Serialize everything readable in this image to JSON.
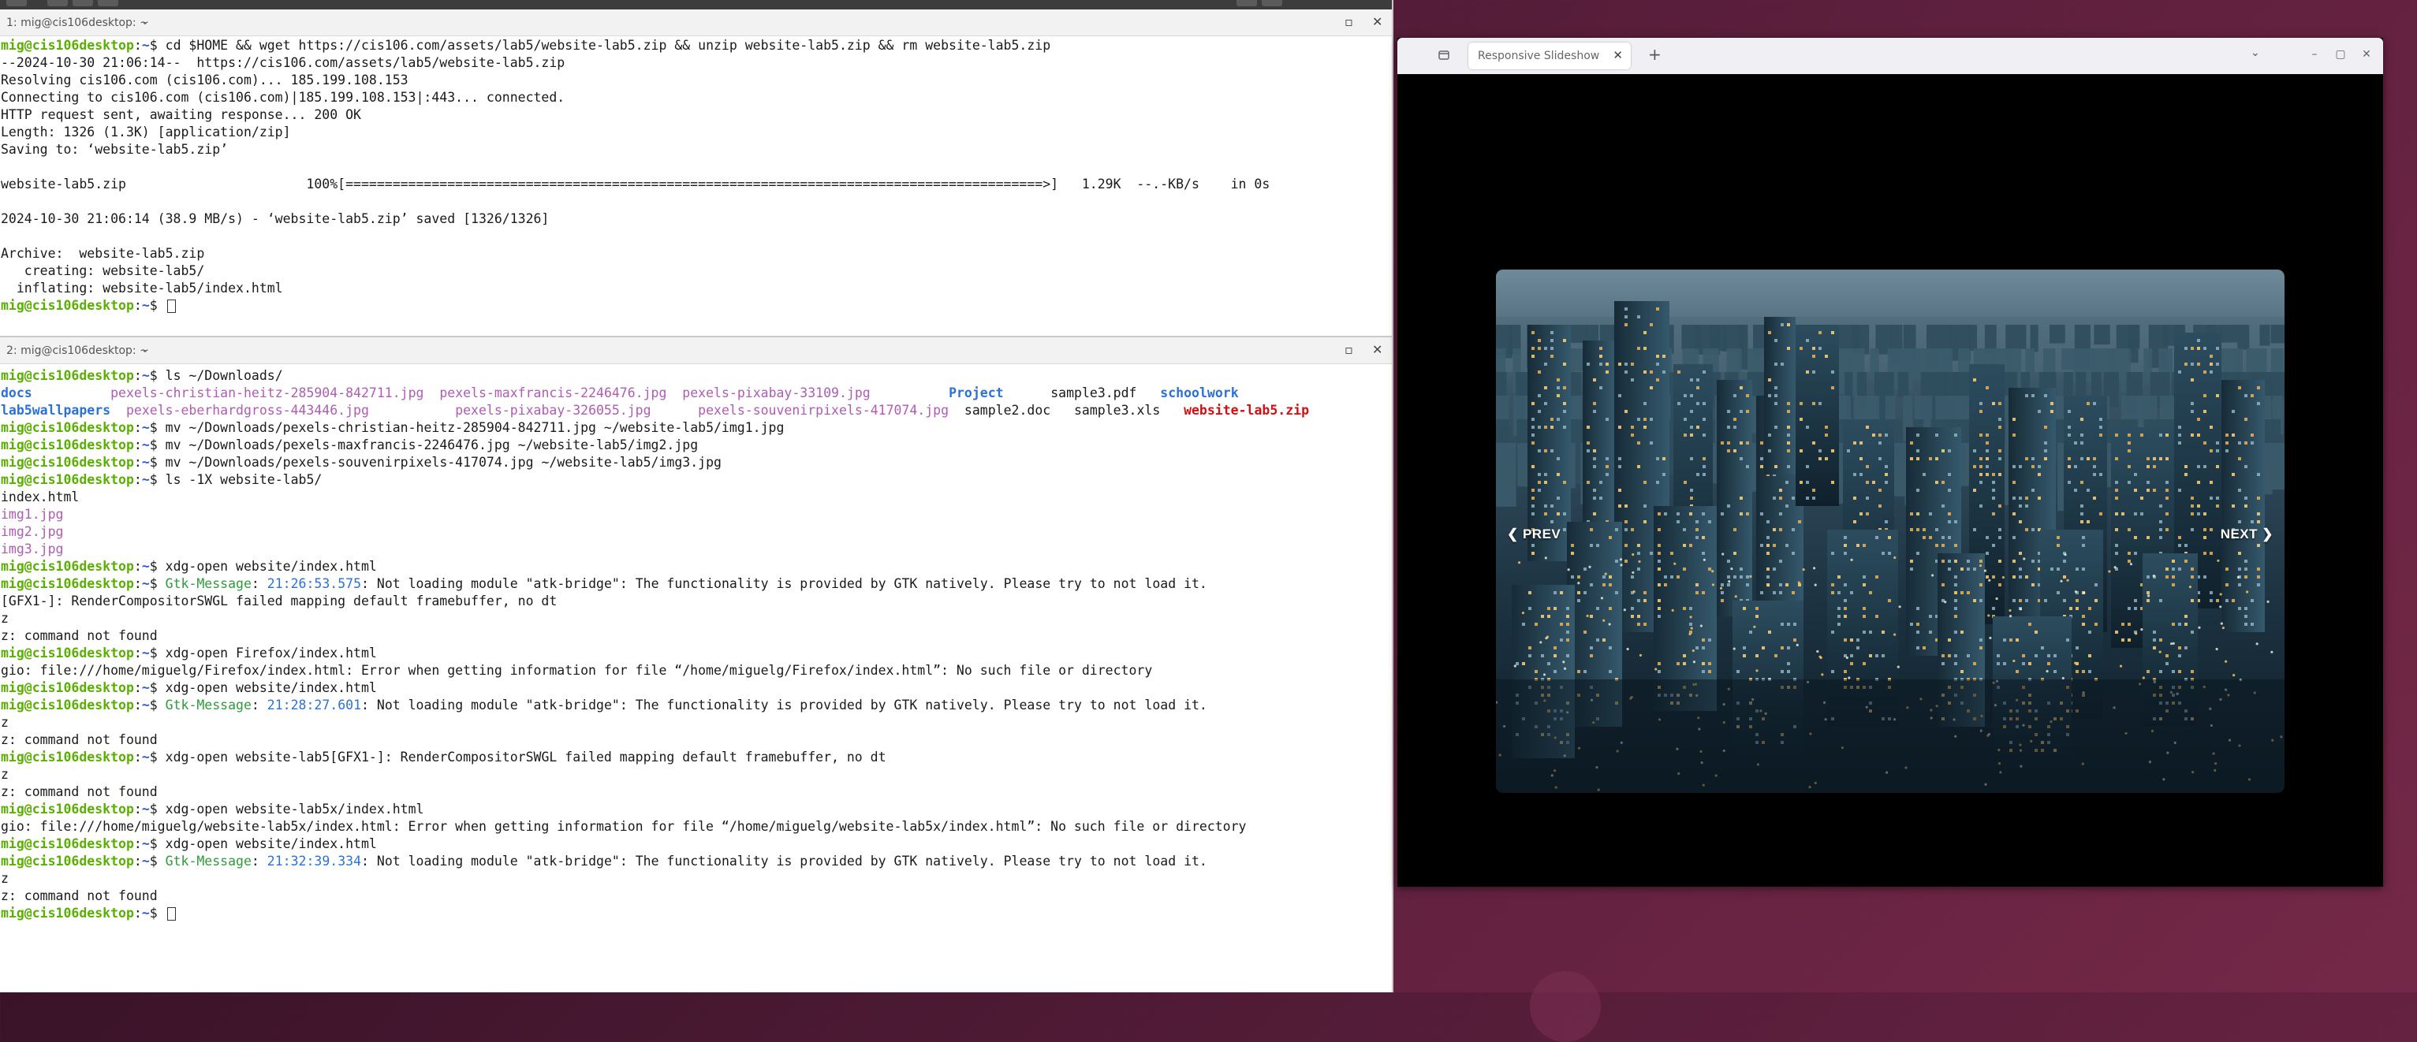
{
  "terminal": {
    "pane1": {
      "title": "1: mig@cis106desktop: ~",
      "lines": [
        [
          [
            "p",
            "mig@cis106desktop"
          ],
          [
            "t",
            ":"
          ],
          [
            "d",
            "~"
          ],
          [
            "t",
            "$ cd $HOME && wget https://cis106.com/assets/lab5/website-lab5.zip && unzip website-lab5.zip && rm website-lab5.zip"
          ]
        ],
        [
          [
            "t",
            "--2024-10-30 21:06:14--  https://cis106.com/assets/lab5/website-lab5.zip"
          ]
        ],
        [
          [
            "t",
            "Resolving cis106.com (cis106.com)... 185.199.108.153"
          ]
        ],
        [
          [
            "t",
            "Connecting to cis106.com (cis106.com)|185.199.108.153|:443... connected."
          ]
        ],
        [
          [
            "t",
            "HTTP request sent, awaiting response... 200 OK"
          ]
        ],
        [
          [
            "t",
            "Length: 1326 (1.3K) [application/zip]"
          ]
        ],
        [
          [
            "t",
            "Saving to: ‘website-lab5.zip’"
          ]
        ],
        [
          [
            "t",
            ""
          ]
        ],
        [
          [
            "t",
            "website-lab5.zip                       100%[=========================================================================================>]   1.29K  --.-KB/s    in 0s"
          ]
        ],
        [
          [
            "t",
            ""
          ]
        ],
        [
          [
            "t",
            "2024-10-30 21:06:14 (38.9 MB/s) - ‘website-lab5.zip’ saved [1326/1326]"
          ]
        ],
        [
          [
            "t",
            ""
          ]
        ],
        [
          [
            "t",
            "Archive:  website-lab5.zip"
          ]
        ],
        [
          [
            "t",
            "   creating: website-lab5/"
          ]
        ],
        [
          [
            "t",
            "  inflating: website-lab5/index.html"
          ]
        ],
        [
          [
            "p",
            "mig@cis106desktop"
          ],
          [
            "t",
            ":"
          ],
          [
            "d",
            "~"
          ],
          [
            "t",
            "$ "
          ],
          [
            "cur",
            ""
          ]
        ]
      ]
    },
    "pane2": {
      "title": "2: mig@cis106desktop: ~",
      "lines": [
        [
          [
            "p",
            "mig@cis106desktop"
          ],
          [
            "t",
            ":"
          ],
          [
            "d",
            "~"
          ],
          [
            "t",
            "$ ls ~/Downloads/"
          ]
        ],
        [
          [
            "dir",
            "docs"
          ],
          [
            "t",
            "          "
          ],
          [
            "img",
            "pexels-christian-heitz-285904-842711.jpg"
          ],
          [
            "t",
            "  "
          ],
          [
            "img",
            "pexels-maxfrancis-2246476.jpg"
          ],
          [
            "t",
            "  "
          ],
          [
            "img",
            "pexels-pixabay-33109.jpg"
          ],
          [
            "t",
            "          "
          ],
          [
            "dir",
            "Project"
          ],
          [
            "t",
            "      sample3.pdf   "
          ],
          [
            "dir",
            "schoolwork"
          ]
        ],
        [
          [
            "dir",
            "lab5wallpapers"
          ],
          [
            "t",
            "  "
          ],
          [
            "img",
            "pexels-eberhardgross-443446.jpg"
          ],
          [
            "t",
            "           "
          ],
          [
            "img",
            "pexels-pixabay-326055.jpg"
          ],
          [
            "t",
            "      "
          ],
          [
            "img",
            "pexels-souvenirpixels-417074.jpg"
          ],
          [
            "t",
            "  sample2.doc   sample3.xls   "
          ],
          [
            "zip",
            "website-lab5.zip"
          ]
        ],
        [
          [
            "p",
            "mig@cis106desktop"
          ],
          [
            "t",
            ":"
          ],
          [
            "d",
            "~"
          ],
          [
            "t",
            "$ mv ~/Downloads/pexels-christian-heitz-285904-842711.jpg ~/website-lab5/img1.jpg"
          ]
        ],
        [
          [
            "p",
            "mig@cis106desktop"
          ],
          [
            "t",
            ":"
          ],
          [
            "d",
            "~"
          ],
          [
            "t",
            "$ mv ~/Downloads/pexels-maxfrancis-2246476.jpg ~/website-lab5/img2.jpg"
          ]
        ],
        [
          [
            "p",
            "mig@cis106desktop"
          ],
          [
            "t",
            ":"
          ],
          [
            "d",
            "~"
          ],
          [
            "t",
            "$ mv ~/Downloads/pexels-souvenirpixels-417074.jpg ~/website-lab5/img3.jpg"
          ]
        ],
        [
          [
            "p",
            "mig@cis106desktop"
          ],
          [
            "t",
            ":"
          ],
          [
            "d",
            "~"
          ],
          [
            "t",
            "$ ls -1X website-lab5/"
          ]
        ],
        [
          [
            "t",
            "index.html"
          ]
        ],
        [
          [
            "img",
            "img1.jpg"
          ]
        ],
        [
          [
            "img",
            "img2.jpg"
          ]
        ],
        [
          [
            "img",
            "img3.jpg"
          ]
        ],
        [
          [
            "p",
            "mig@cis106desktop"
          ],
          [
            "t",
            ":"
          ],
          [
            "d",
            "~"
          ],
          [
            "t",
            "$ xdg-open website/index.html"
          ]
        ],
        [
          [
            "p",
            "mig@cis106desktop"
          ],
          [
            "t",
            ":"
          ],
          [
            "d",
            "~"
          ],
          [
            "t",
            "$ "
          ],
          [
            "g",
            "Gtk-Message"
          ],
          [
            "t",
            ": "
          ],
          [
            "tm",
            "21:26:53.575"
          ],
          [
            "t",
            ": Not loading module \"atk-bridge\": The functionality is provided by GTK natively. Please try to not load it."
          ]
        ],
        [
          [
            "t",
            "[GFX1-]: RenderCompositorSWGL failed mapping default framebuffer, no dt"
          ]
        ],
        [
          [
            "t",
            "z"
          ]
        ],
        [
          [
            "t",
            "z: command not found"
          ]
        ],
        [
          [
            "p",
            "mig@cis106desktop"
          ],
          [
            "t",
            ":"
          ],
          [
            "d",
            "~"
          ],
          [
            "t",
            "$ xdg-open Firefox/index.html"
          ]
        ],
        [
          [
            "t",
            "gio: file:///home/miguelg/Firefox/index.html: Error when getting information for file “/home/miguelg/Firefox/index.html”: No such file or directory"
          ]
        ],
        [
          [
            "p",
            "mig@cis106desktop"
          ],
          [
            "t",
            ":"
          ],
          [
            "d",
            "~"
          ],
          [
            "t",
            "$ xdg-open website/index.html"
          ]
        ],
        [
          [
            "p",
            "mig@cis106desktop"
          ],
          [
            "t",
            ":"
          ],
          [
            "d",
            "~"
          ],
          [
            "t",
            "$ "
          ],
          [
            "g",
            "Gtk-Message"
          ],
          [
            "t",
            ": "
          ],
          [
            "tm",
            "21:28:27.601"
          ],
          [
            "t",
            ": Not loading module \"atk-bridge\": The functionality is provided by GTK natively. Please try to not load it."
          ]
        ],
        [
          [
            "t",
            "z"
          ]
        ],
        [
          [
            "t",
            "z: command not found"
          ]
        ],
        [
          [
            "p",
            "mig@cis106desktop"
          ],
          [
            "t",
            ":"
          ],
          [
            "d",
            "~"
          ],
          [
            "t",
            "$ xdg-open website-lab5[GFX1-]: RenderCompositorSWGL failed mapping default framebuffer, no dt"
          ]
        ],
        [
          [
            "t",
            "z"
          ]
        ],
        [
          [
            "t",
            "z: command not found"
          ]
        ],
        [
          [
            "p",
            "mig@cis106desktop"
          ],
          [
            "t",
            ":"
          ],
          [
            "d",
            "~"
          ],
          [
            "t",
            "$ xdg-open website-lab5x/index.html"
          ]
        ],
        [
          [
            "t",
            "gio: file:///home/miguelg/website-lab5x/index.html: Error when getting information for file “/home/miguelg/website-lab5x/index.html”: No such file or directory"
          ]
        ],
        [
          [
            "p",
            "mig@cis106desktop"
          ],
          [
            "t",
            ":"
          ],
          [
            "d",
            "~"
          ],
          [
            "t",
            "$ xdg-open website/index.html"
          ]
        ],
        [
          [
            "p",
            "mig@cis106desktop"
          ],
          [
            "t",
            ":"
          ],
          [
            "d",
            "~"
          ],
          [
            "t",
            "$ "
          ],
          [
            "g",
            "Gtk-Message"
          ],
          [
            "t",
            ": "
          ],
          [
            "tm",
            "21:32:39.334"
          ],
          [
            "t",
            ": Not loading module \"atk-bridge\": The functionality is provided by GTK natively. Please try to not load it."
          ]
        ],
        [
          [
            "t",
            "z"
          ]
        ],
        [
          [
            "t",
            "z: command not found"
          ]
        ],
        [
          [
            "p",
            "mig@cis106desktop"
          ],
          [
            "t",
            ":"
          ],
          [
            "d",
            "~"
          ],
          [
            "t",
            "$ "
          ],
          [
            "cur",
            ""
          ]
        ]
      ]
    }
  },
  "browser": {
    "tab_title": "Responsive Slideshow",
    "prev_label": "❮ PREV",
    "next_label": "NEXT ❯"
  },
  "colors": {
    "prompt_user": "#5ab000",
    "prompt_path": "#2c5bd6",
    "directory": "#2a72d6",
    "image_file": "#b05bb5",
    "archive_file": "#d11111",
    "gtk_message": "#2d9c3a",
    "desktop_bg": "#5c1f3d"
  }
}
